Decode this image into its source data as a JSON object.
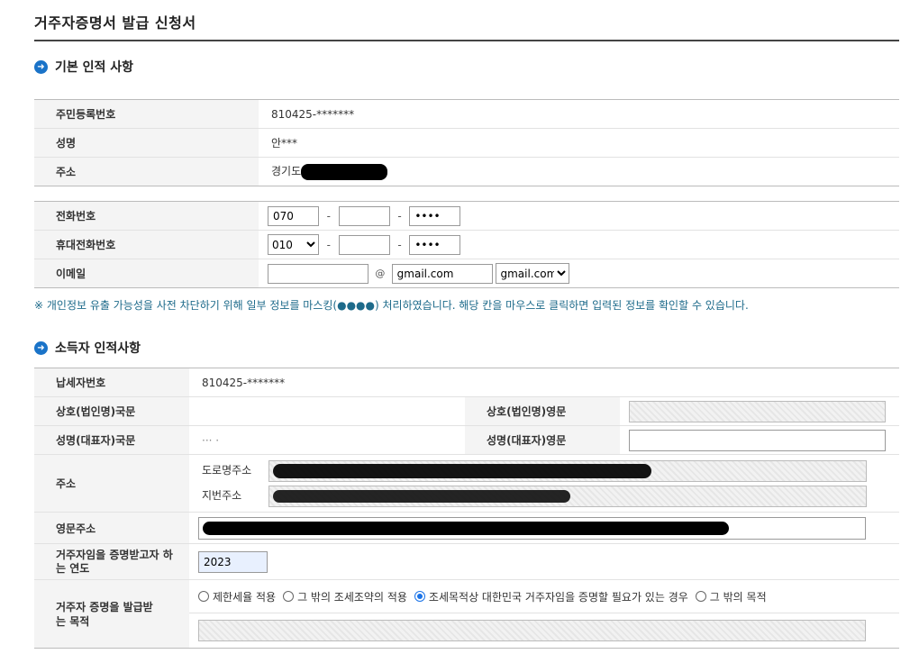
{
  "page": {
    "title": "거주자증명서 발급 신청서"
  },
  "basic": {
    "section_title": "기본 인적 사항",
    "rrn_label": "주민등록번호",
    "rrn_value": "810425-*******",
    "name_label": "성명",
    "name_value": "안***",
    "address_label": "주소",
    "address_value": "경기도",
    "phone_label": "전화번호",
    "phone1": "070",
    "phone2": "",
    "phone3": "••••",
    "mobile_label": "휴대전화번호",
    "mobile1": "010",
    "mobile1_options": [
      "010"
    ],
    "mobile2": "",
    "mobile3": "••••",
    "email_label": "이메일",
    "email_id": "",
    "email_at": "@",
    "email_domain": "gmail.com",
    "email_domain_select": "gmail.com"
  },
  "notice": "※ 개인정보 유출 가능성을 사전 차단하기 위해 일부 정보를 마스킹(●●●●) 처리하였습니다. 해당 칸을 마우스로 클릭하면 입력된 정보를 확인할 수 있습니다.",
  "income": {
    "section_title": "소득자 인적사항",
    "tin_label": "납세자번호",
    "tin_value": "810425-*******",
    "corp_kr_label": "상호(법인명)국문",
    "corp_kr_value": "",
    "corp_en_label": "상호(법인명)영문",
    "rep_kr_label": "성명(대표자)국문",
    "rep_kr_value": "··· ·",
    "rep_en_label": "성명(대표자)영문",
    "address_label": "주소",
    "road_label": "도로명주소",
    "lot_label": "지번주소",
    "en_address_label": "영문주소",
    "year_label": "거주자임을 증명받고자 하는 연도",
    "year_value": "2023",
    "purpose_label": "거주자 증명을 발급받는 목적",
    "purpose_options": [
      "제한세율 적용",
      "그 밖의 조세조약의 적용",
      "조세목적상 대한민국 거주자임을 증명할 필요가 있는 경우",
      "그 밖의 목적"
    ],
    "purpose_selected": 2
  },
  "colors": {
    "accent": "#1a73c8",
    "notice": "#1d6a8a"
  }
}
